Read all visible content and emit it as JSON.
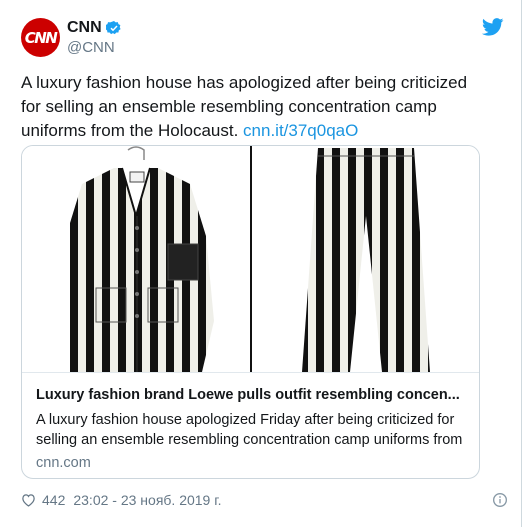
{
  "author": {
    "avatar_text": "CNN",
    "name": "CNN",
    "handle": "@CNN",
    "verified": true
  },
  "tweet": {
    "text": "A luxury fashion house has apologized after being criticized for selling an ensemble resembling concentration camp uniforms from the Holocaust.",
    "link_text": "cnn.it/37q0qaO"
  },
  "card": {
    "title": "Luxury fashion brand Loewe pulls outfit resembling concen...",
    "description": "A luxury fashion house apologized Friday after being criticized for selling an ensemble resembling concentration camp uniforms from",
    "domain": "cnn.com",
    "images": [
      "striped-jacket",
      "striped-trousers"
    ]
  },
  "footer": {
    "likes": "442",
    "timestamp": "23:02 - 23 нояб. 2019 г."
  },
  "icons": {
    "verified": "verified-badge-icon",
    "bird": "twitter-bird-icon",
    "heart": "heart-icon",
    "info": "info-icon"
  },
  "colors": {
    "brand": "#1da1f2",
    "link": "#1b95e0",
    "avatar": "#cc0000",
    "muted": "#657786"
  }
}
